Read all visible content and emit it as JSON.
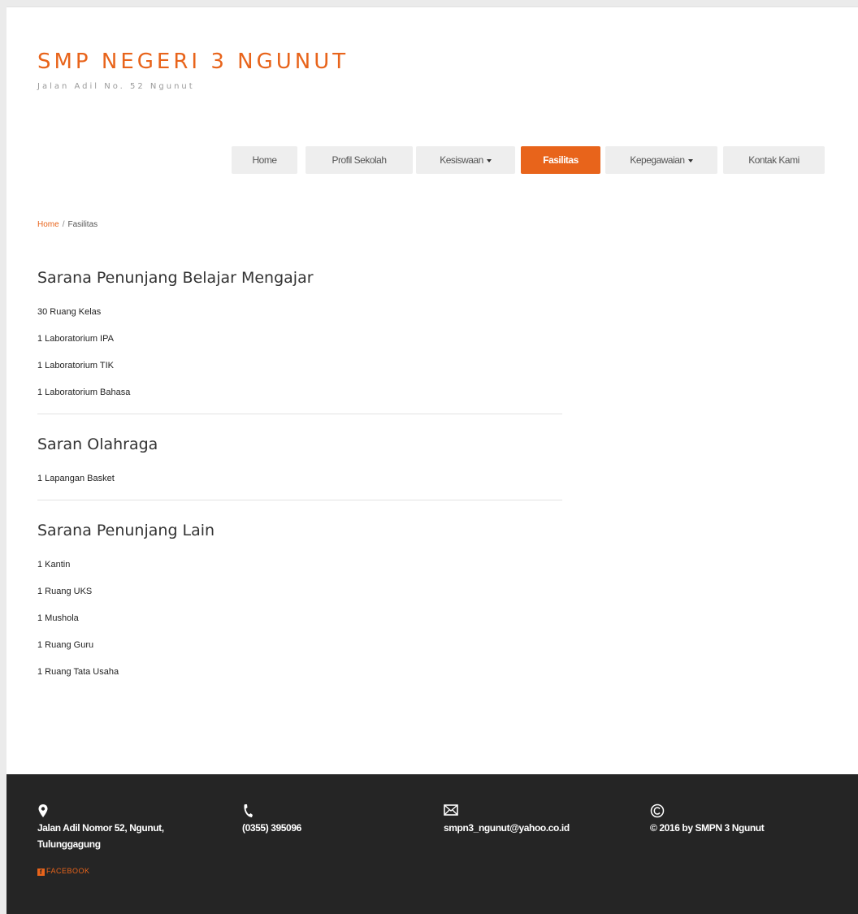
{
  "site": {
    "title": "SMP NEGERI 3 NGUNUT",
    "subtitle": "Jalan Adil No. 52 Ngunut"
  },
  "nav": {
    "items": [
      {
        "label": "Home"
      },
      {
        "label": "Profil Sekolah"
      },
      {
        "label": "Kesiswaan"
      },
      {
        "label": "Fasilitas"
      },
      {
        "label": "Kepegawaian"
      },
      {
        "label": "Kontak Kami"
      }
    ],
    "active": "Fasilitas"
  },
  "breadcrumb": {
    "home": "Home",
    "separator": "/",
    "current": "Fasilitas"
  },
  "sections": [
    {
      "title": "Sarana Penunjang Belajar Mengajar",
      "items": [
        "30 Ruang Kelas",
        "1  Laboratorium IPA",
        "1  Laboratorium TIK",
        "1  Laboratorium Bahasa"
      ]
    },
    {
      "title": "Saran Olahraga",
      "items": [
        "1 Lapangan Basket"
      ]
    },
    {
      "title": "Sarana Penunjang Lain",
      "items": [
        "1 Kantin",
        "1  Ruang UKS",
        "1  Mushola",
        "1  Ruang Guru",
        "1  Ruang Tata Usaha"
      ]
    }
  ],
  "footer": {
    "address": "Jalan Adil Nomor 52, Ngunut, Tulunggagung",
    "phone": "(0355) 395096",
    "email": "smpn3_ngunut@yahoo.co.id",
    "copyright": "© 2016 by SMPN 3 Ngunut",
    "facebook": "FACEBOOK",
    "facebook_icon_letter": "f"
  },
  "icons": {
    "address": "map-pin-icon",
    "phone": "phone-icon",
    "email": "envelope-icon",
    "copyright": "copyright-icon",
    "facebook": "facebook-icon"
  },
  "colors": {
    "accent": "#e8641b",
    "footer_bg": "#252525",
    "nav_bg": "#eeeeee"
  }
}
